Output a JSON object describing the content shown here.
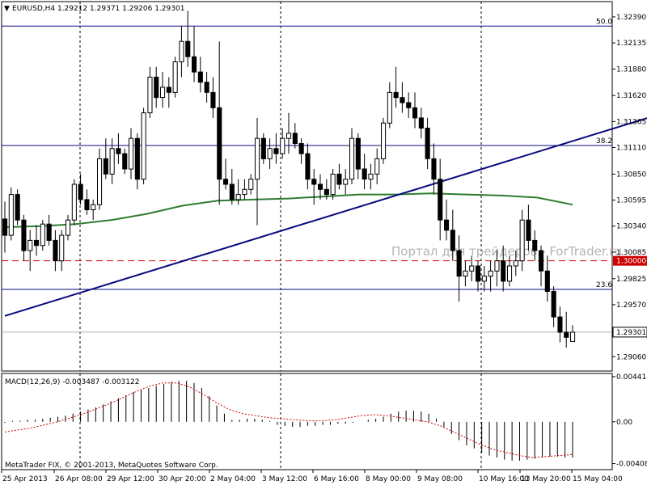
{
  "header": {
    "symbol_line": "EURUSD,H4  1.29212 1.29371 1.29206 1.29301"
  },
  "macd_header": "MACD(12,26,9) -0.003487 -0.003122",
  "copyright": "MetaTrader FIX, © 2001-2013, MetaQuotes Software Corp.",
  "watermark": "Портал для трейдеров - ForTrader.ru",
  "colors": {
    "background": "#ffffff",
    "bull_candle": "#ffffff",
    "bear_candle": "#000000",
    "moving_average": "#2e7d32",
    "trendline": "#0a0a80",
    "fibo_lines": "#0a0a80",
    "level_line": "#cc0000",
    "price_badge": "#cc0000",
    "macd_signal": "#cc0000"
  },
  "chart_data": {
    "type": "candlestick",
    "symbol": "EURUSD",
    "timeframe": "H4",
    "price_axis": {
      "ylim": [
        1.2892,
        1.3254
      ],
      "ticks": [
        "1.32390",
        "1.32135",
        "1.31880",
        "1.31620",
        "1.31365",
        "1.31110",
        "1.30850",
        "1.30595",
        "1.30340",
        "1.30085",
        "1.29825",
        "1.29570",
        "1.29315",
        "1.29060"
      ]
    },
    "time_axis_labels": [
      "25 Apr 2013",
      "26 Apr 08:00",
      "29 Apr 12:00",
      "30 Apr 20:00",
      "2 May 04:00",
      "3 May 12:00",
      "6 May 16:00",
      "8 May 00:00",
      "9 May 08:00",
      "10 May 16:00",
      "13 May 20:00",
      "15 May 04:00"
    ],
    "current_price": "1.29301",
    "level_label": "1.30000",
    "fibonacci": [
      {
        "label": "50.0",
        "price": 1.323
      },
      {
        "label": "38.2",
        "price": 1.3113
      },
      {
        "label": "23.6",
        "price": 1.2972
      }
    ],
    "horizontal_level": 1.3,
    "trendline": [
      {
        "bar": 0,
        "price": 1.2946
      },
      {
        "bar": 104,
        "price": 1.3144
      }
    ],
    "moving_average": [
      1.3033,
      1.3034,
      1.3036,
      1.304,
      1.3046,
      1.3054,
      1.3059,
      1.306,
      1.3061,
      1.3063,
      1.3065,
      1.3065,
      1.3066,
      1.3065,
      1.3064,
      1.3062,
      1.3055
    ],
    "candles": [
      [
        1.3041,
        1.3058,
        1.3008,
        1.3025
      ],
      [
        1.3025,
        1.3072,
        1.302,
        1.3065
      ],
      [
        1.3065,
        1.307,
        1.3035,
        1.304
      ],
      [
        1.304,
        1.3045,
        1.3,
        1.301
      ],
      [
        1.301,
        1.303,
        1.299,
        1.302
      ],
      [
        1.302,
        1.3035,
        1.3005,
        1.3015
      ],
      [
        1.3015,
        1.304,
        1.301,
        1.3036
      ],
      [
        1.3036,
        1.3045,
        1.3015,
        1.302
      ],
      [
        1.302,
        1.303,
        1.299,
        1.3
      ],
      [
        1.3,
        1.303,
        1.299,
        1.3025
      ],
      [
        1.3025,
        1.3045,
        1.302,
        1.304
      ],
      [
        1.304,
        1.308,
        1.3035,
        1.3075
      ],
      [
        1.3075,
        1.3085,
        1.3055,
        1.306
      ],
      [
        1.306,
        1.307,
        1.3045,
        1.305
      ],
      [
        1.305,
        1.306,
        1.304,
        1.3055
      ],
      [
        1.3055,
        1.311,
        1.305,
        1.31
      ],
      [
        1.31,
        1.312,
        1.308,
        1.3085
      ],
      [
        1.3085,
        1.312,
        1.3075,
        1.311
      ],
      [
        1.311,
        1.3125,
        1.3095,
        1.3105
      ],
      [
        1.3105,
        1.311,
        1.3085,
        1.309
      ],
      [
        1.309,
        1.313,
        1.308,
        1.312
      ],
      [
        1.312,
        1.3125,
        1.307,
        1.308
      ],
      [
        1.308,
        1.315,
        1.3075,
        1.3145
      ],
      [
        1.3145,
        1.319,
        1.314,
        1.318
      ],
      [
        1.318,
        1.319,
        1.315,
        1.316
      ],
      [
        1.316,
        1.3185,
        1.315,
        1.317
      ],
      [
        1.317,
        1.318,
        1.315,
        1.3165
      ],
      [
        1.3165,
        1.32,
        1.316,
        1.3195
      ],
      [
        1.3195,
        1.323,
        1.318,
        1.3215
      ],
      [
        1.3215,
        1.3245,
        1.319,
        1.32
      ],
      [
        1.32,
        1.323,
        1.3175,
        1.3185
      ],
      [
        1.3185,
        1.32,
        1.3165,
        1.3175
      ],
      [
        1.3175,
        1.3185,
        1.3155,
        1.3165
      ],
      [
        1.3165,
        1.318,
        1.314,
        1.315
      ],
      [
        1.315,
        1.3215,
        1.3055,
        1.308
      ],
      [
        1.308,
        1.31,
        1.307,
        1.3075
      ],
      [
        1.3075,
        1.309,
        1.3055,
        1.306
      ],
      [
        1.306,
        1.308,
        1.3055,
        1.3065
      ],
      [
        1.3065,
        1.308,
        1.306,
        1.307
      ],
      [
        1.307,
        1.3085,
        1.3065,
        1.308
      ],
      [
        1.308,
        1.314,
        1.3035,
        1.312
      ],
      [
        1.312,
        1.3125,
        1.3095,
        1.31
      ],
      [
        1.31,
        1.312,
        1.309,
        1.311
      ],
      [
        1.311,
        1.3125,
        1.3095,
        1.3105
      ],
      [
        1.3105,
        1.313,
        1.31,
        1.312
      ],
      [
        1.312,
        1.3145,
        1.3105,
        1.3125
      ],
      [
        1.3125,
        1.3135,
        1.311,
        1.3115
      ],
      [
        1.3115,
        1.312,
        1.3095,
        1.3105
      ],
      [
        1.3105,
        1.3115,
        1.307,
        1.308
      ],
      [
        1.308,
        1.309,
        1.3055,
        1.3075
      ],
      [
        1.3075,
        1.3085,
        1.306,
        1.307
      ],
      [
        1.307,
        1.308,
        1.306,
        1.3065
      ],
      [
        1.3065,
        1.309,
        1.306,
        1.3085
      ],
      [
        1.3085,
        1.3095,
        1.307,
        1.3075
      ],
      [
        1.3075,
        1.309,
        1.3065,
        1.308
      ],
      [
        1.308,
        1.313,
        1.3075,
        1.312
      ],
      [
        1.312,
        1.3125,
        1.308,
        1.309
      ],
      [
        1.309,
        1.3105,
        1.307,
        1.308
      ],
      [
        1.308,
        1.3095,
        1.307,
        1.3085
      ],
      [
        1.3085,
        1.311,
        1.3075,
        1.31
      ],
      [
        1.31,
        1.314,
        1.3095,
        1.3135
      ],
      [
        1.3135,
        1.3175,
        1.313,
        1.3165
      ],
      [
        1.3165,
        1.319,
        1.315,
        1.316
      ],
      [
        1.316,
        1.3175,
        1.3145,
        1.3155
      ],
      [
        1.3155,
        1.3165,
        1.314,
        1.315
      ],
      [
        1.315,
        1.3165,
        1.313,
        1.314
      ],
      [
        1.314,
        1.315,
        1.312,
        1.313
      ],
      [
        1.313,
        1.314,
        1.309,
        1.31
      ],
      [
        1.31,
        1.3115,
        1.3065,
        1.308
      ],
      [
        1.308,
        1.31,
        1.302,
        1.304
      ],
      [
        1.304,
        1.306,
        1.302,
        1.303
      ],
      [
        1.303,
        1.305,
        1.3,
        1.301
      ],
      [
        1.301,
        1.3025,
        1.296,
        1.2985
      ],
      [
        1.2985,
        1.3,
        1.2975,
        1.299
      ],
      [
        1.299,
        1.3005,
        1.298,
        1.2995
      ],
      [
        1.2995,
        1.3,
        1.297,
        1.298
      ],
      [
        1.298,
        1.2995,
        1.297,
        1.2985
      ],
      [
        1.2985,
        1.3,
        1.297,
        1.299
      ],
      [
        1.299,
        1.301,
        1.2975,
        1.3
      ],
      [
        1.3,
        1.3015,
        1.297,
        1.298
      ],
      [
        1.298,
        1.3005,
        1.2975,
        1.2995
      ],
      [
        1.2995,
        1.301,
        1.2985,
        1.3
      ],
      [
        1.3,
        1.305,
        1.299,
        1.304
      ],
      [
        1.304,
        1.3055,
        1.301,
        1.302
      ],
      [
        1.302,
        1.303,
        1.3,
        1.301
      ],
      [
        1.301,
        1.3015,
        1.2975,
        1.299
      ],
      [
        1.299,
        1.3005,
        1.296,
        1.297
      ],
      [
        1.297,
        1.2975,
        1.2935,
        1.2945
      ],
      [
        1.2945,
        1.2955,
        1.292,
        1.293
      ],
      [
        1.293,
        1.295,
        1.2915,
        1.2925
      ],
      [
        1.2921,
        1.2937,
        1.2921,
        1.293
      ]
    ],
    "macd": {
      "ylim": [
        -0.00436,
        0.00441
      ],
      "ticks": [
        "0.004414",
        "0.00",
        "-0.004087"
      ],
      "histogram": [
        -0.0001,
        0.0001,
        0.0001,
        0.0002,
        0.0002,
        0.0003,
        0.0004,
        0.0005,
        0.0006,
        0.0008,
        0.001,
        0.0012,
        0.0014,
        0.0017,
        0.002,
        0.0023,
        0.0026,
        0.0029,
        0.0031,
        0.0033,
        0.0035,
        0.0037,
        0.0039,
        0.004,
        0.004,
        0.0038,
        0.0033,
        0.0025,
        0.0016,
        0.0008,
        0.0002,
        0.0002,
        0.0003,
        0.0003,
        0.0002,
        0.0001,
        -0.0003,
        -0.0004,
        -0.0005,
        -0.0005,
        -0.0004,
        -0.0004,
        -0.0003,
        -0.0003,
        -0.0002,
        -0.0002,
        -0.0001,
        0.0,
        0.0002,
        0.0003,
        0.0005,
        0.0008,
        0.001,
        0.0011,
        0.0011,
        0.001,
        0.0008,
        0.0003,
        -0.0005,
        -0.0012,
        -0.0018,
        -0.0023,
        -0.0026,
        -0.003,
        -0.0033,
        -0.0035,
        -0.0037,
        -0.0038,
        -0.0038,
        -0.0037,
        -0.0036,
        -0.0035,
        -0.0034,
        -0.0034,
        -0.0035,
        -0.0035
      ],
      "signal": [
        -0.001,
        -0.0008,
        -0.0006,
        -0.0003,
        0.0,
        0.0004,
        0.0008,
        0.0013,
        0.0018,
        0.0024,
        0.003,
        0.0035,
        0.0038,
        0.0038,
        0.0034,
        0.0027,
        0.0019,
        0.0012,
        0.0008,
        0.0006,
        0.0004,
        0.0003,
        0.0002,
        0.0001,
        0.0001,
        0.0002,
        0.0004,
        0.0006,
        0.0007,
        0.0006,
        0.0004,
        0.0002,
        0.0,
        -0.0004,
        -0.001,
        -0.0016,
        -0.0022,
        -0.0027,
        -0.003,
        -0.0033,
        -0.0035,
        -0.0034,
        -0.0033,
        -0.0032
      ]
    }
  }
}
